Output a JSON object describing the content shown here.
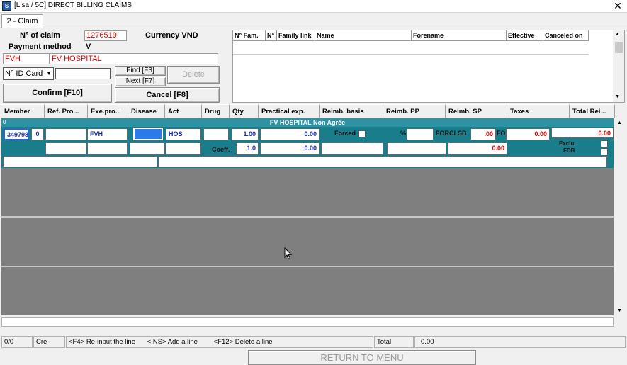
{
  "window": {
    "title": "[Lisa / 5C] DIRECT BILLING CLAIMS",
    "close": "✕",
    "app_icon": "S"
  },
  "tabs": [
    {
      "label": "2 - Claim"
    }
  ],
  "claim": {
    "claim_no_label": "N° of claim",
    "claim_no": "1276519",
    "currency_label": "Currency VND",
    "payment_label": "Payment method",
    "payment_value": "V",
    "provider_code": "FVH",
    "provider_name": "FV HOSPITAL"
  },
  "search": {
    "id_type": "N° ID Card",
    "id_value": ""
  },
  "buttons": {
    "find": "Find [F3]",
    "next": "Next [F7]",
    "delete": "Delete",
    "confirm": "Confirm [F10]",
    "cancel": "Cancel [F8]"
  },
  "family_table": {
    "headers": [
      "N° Fam.",
      "N°",
      "Family link",
      "Name",
      "Forename",
      "Effective",
      "Canceled on"
    ]
  },
  "columns": [
    "Member",
    "Ref. Pro...",
    "Exe.pro...",
    "Disease",
    "Act",
    "Drug",
    "Qty",
    "Practical exp.",
    "Reimb. basis",
    "Reimb. PP",
    "Reimb. SP",
    "Taxes",
    "Total Rei..."
  ],
  "line": {
    "index": "0",
    "banner": "FV HOSPITAL Non Agrée",
    "member": "349798",
    "member_seq": "0",
    "exe_pro": "FVH",
    "act": "HOS",
    "qty": "1.00",
    "practical_exp": "0.00",
    "forced_label": "Forced",
    "pct_label": "%",
    "forcl_label": "FORCLSB",
    "reimb_pp": ".00",
    "fo_label": "FO",
    "reimb_sp": "0.00",
    "total": "0.00",
    "coeff_label": "Coeff.",
    "coeff": "1.0",
    "basis_row2": "0.00",
    "sp_row2": "0.00",
    "exclu_label": "Exclu.",
    "fdb_label": "FDB"
  },
  "status_bar": {
    "counter": "0/0",
    "mode": "Cre",
    "hint_f4": "<F4> Re-input the line",
    "hint_ins": "<INS> Add a line",
    "hint_f12": "<F12> Delete a line",
    "total_label": "Total",
    "total_value": "0.00"
  },
  "footer": {
    "return_label": "RETURN TO MENU"
  }
}
